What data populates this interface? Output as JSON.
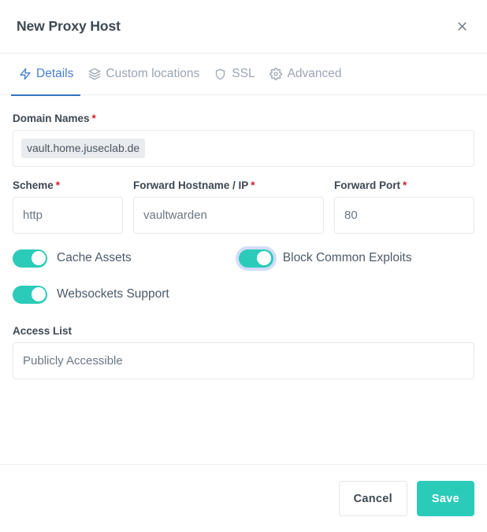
{
  "header": {
    "title": "New Proxy Host",
    "close_icon": "close-icon"
  },
  "tabs": [
    {
      "label": "Details",
      "icon": "zap-icon",
      "active": true
    },
    {
      "label": "Custom locations",
      "icon": "layers-icon",
      "active": false
    },
    {
      "label": "SSL",
      "icon": "shield-icon",
      "active": false
    },
    {
      "label": "Advanced",
      "icon": "gear-icon",
      "active": false
    }
  ],
  "form": {
    "domain_names": {
      "label": "Domain Names",
      "required_marker": "*",
      "tags": [
        "vault.home.juseclab.de"
      ]
    },
    "scheme": {
      "label": "Scheme",
      "required_marker": "*",
      "value": "http"
    },
    "forward_hostname": {
      "label": "Forward Hostname / IP",
      "required_marker": "*",
      "value": "vaultwarden"
    },
    "forward_port": {
      "label": "Forward Port",
      "required_marker": "*",
      "value": "80"
    },
    "toggles": [
      {
        "label": "Cache Assets",
        "on": true,
        "focused": false
      },
      {
        "label": "Block Common Exploits",
        "on": true,
        "focused": true
      },
      {
        "label": "Websockets Support",
        "on": true,
        "focused": false
      }
    ],
    "access_list": {
      "label": "Access List",
      "value": "Publicly Accessible"
    }
  },
  "footer": {
    "cancel_label": "Cancel",
    "save_label": "Save"
  },
  "colors": {
    "accent_teal": "#2bcbba",
    "tab_active_blue": "#467fcf",
    "required_red": "#cd2029",
    "text_dark": "#3d4852",
    "text_muted": "#9aa5b1"
  }
}
